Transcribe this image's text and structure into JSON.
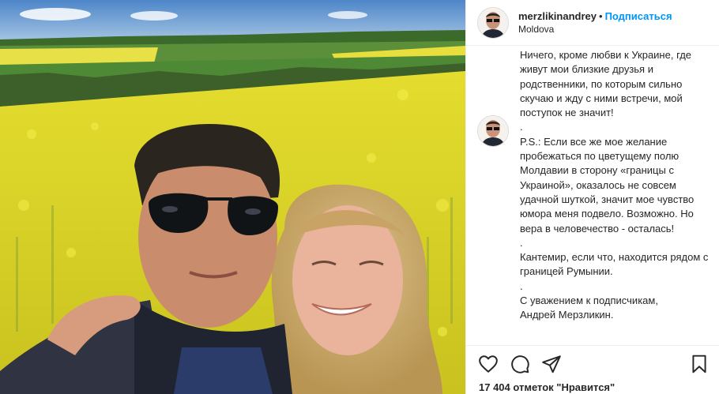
{
  "post": {
    "username": "merzlikinandrey",
    "separator": "•",
    "follow_label": "Подписаться",
    "location": "Moldova",
    "caption": "Ничего, кроме любви к Украине, где живут мои близкие друзья и родственники, по которым сильно скучаю и жду с ними встречи, мой поступок не значит!\n.\nP.S.: Если все же мое желание пробежаться по цветущему полю Молдавии в сторону «границы с Украиной», оказалось не совсем удачной шуткой, значит мое чувство юмора меня подвело. Возможно. Но вера в человечество - осталась!\n.\nКантемир, если что, находится рядом с границей Румынии.\n.\nС уважением к подписчикам,\nАндрей Мерзликин.",
    "likes_text": "17 404 отметок \"Нравится\""
  },
  "icons": {
    "like": "heart-icon",
    "comment": "comment-icon",
    "share": "share-icon",
    "save": "bookmark-icon"
  },
  "colors": {
    "accent": "#0095f6",
    "text": "#262626",
    "divider": "#efefef",
    "field": "#e8e23a"
  }
}
